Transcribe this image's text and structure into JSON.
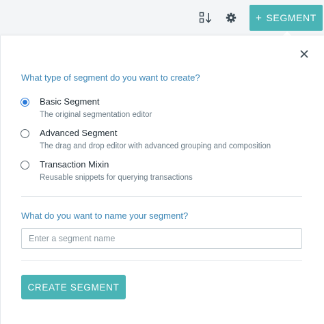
{
  "toolbar": {
    "sort_icon": "sort-list-icon",
    "settings_icon": "gear-icon",
    "add_segment_plus": "+",
    "add_segment_label": "SEGMENT"
  },
  "dialog": {
    "close_icon": "close-icon",
    "type_question": "What type of segment do you want to create?",
    "options": [
      {
        "title": "Basic Segment",
        "description": "The original segmentation editor",
        "selected": true
      },
      {
        "title": "Advanced Segment",
        "description": "The drag and drop editor with advanced grouping and composition",
        "selected": false
      },
      {
        "title": "Transaction Mixin",
        "description": "Reusable snippets for querying transactions",
        "selected": false
      }
    ],
    "name_question": "What do you want to name your segment?",
    "name_input": {
      "value": "",
      "placeholder": "Enter a segment name"
    },
    "create_button": "CREATE SEGMENT"
  },
  "colors": {
    "accent": "#4ab4b6",
    "question_text": "#3a85b5",
    "radio_selected": "#2a7ad9"
  }
}
